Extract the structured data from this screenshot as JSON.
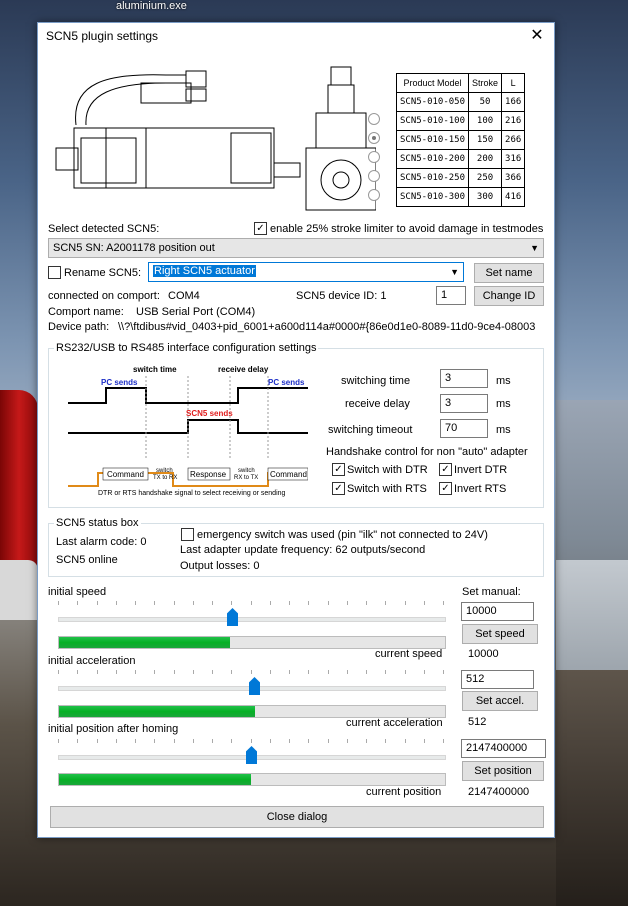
{
  "desktop": {
    "top_label": "aluminium.exe"
  },
  "dialog": {
    "title": "SCN5 plugin settings",
    "close_glyph": "✕"
  },
  "product_table": {
    "headers": [
      "Product Model",
      "Stroke",
      "L"
    ],
    "rows": [
      [
        "SCN5-010-050",
        "50",
        "166"
      ],
      [
        "SCN5-010-100",
        "100",
        "216"
      ],
      [
        "SCN5-010-150",
        "150",
        "266"
      ],
      [
        "SCN5-010-200",
        "200",
        "316"
      ],
      [
        "SCN5-010-250",
        "250",
        "366"
      ],
      [
        "SCN5-010-300",
        "300",
        "416"
      ]
    ],
    "selected_index": 1
  },
  "device": {
    "select_label": "Select detected SCN5:",
    "stroke_limiter_label": "enable 25% stroke limiter to avoid damage in testmodes",
    "stroke_limiter_checked": true,
    "selected_device": "SCN5 SN: A2001178 position out",
    "rename_label": "Rename SCN5:",
    "rename_checked": false,
    "rename_value": "Right SCN5 actuator",
    "set_name_button": "Set name",
    "comport_label": "connected on comport:",
    "comport_value": "COM4",
    "device_id_label": "SCN5 device ID: 1",
    "device_id_value": "1",
    "change_id_button": "Change ID",
    "comport_name_label": "Comport name:",
    "comport_name_value": "USB Serial Port (COM4)",
    "device_path_label": "Device path:",
    "device_path_value": "\\\\?\\ftdibus#vid_0403+pid_6001+a600d114a#0000#{86e0d1e0-8089-11d0-9ce4-08003"
  },
  "rs232": {
    "group_title": "RS232/USB to RS485 interface configuration settings",
    "diagram": {
      "switch_time": "switch time",
      "receive_delay": "receive delay",
      "pc_sends": "PC sends",
      "scn5_sends": "SCN5 sends",
      "command": "Command",
      "switch_tx_rx_1": "switch",
      "switch_tx_rx_2": "TX to RX",
      "response": "Response",
      "switch_rx_tx_1": "switch",
      "switch_rx_tx_2": "RX to TX",
      "handshake_caption": "DTR or RTS handshake signal to select receiving or sending"
    },
    "switching_time_label": "switching time",
    "switching_time_value": "3",
    "receive_delay_label": "receive delay",
    "receive_delay_value": "3",
    "switching_timeout_label": "switching timeout",
    "switching_timeout_value": "70",
    "unit_ms": "ms",
    "handshake_label": "Handshake control for non \"auto\" adapter",
    "switch_dtr_label": "Switch with DTR",
    "invert_dtr_label": "Invert DTR",
    "switch_rts_label": "Switch with RTS",
    "invert_rts_label": "Invert RTS",
    "switch_dtr_checked": true,
    "invert_dtr_checked": true,
    "switch_rts_checked": true,
    "invert_rts_checked": true
  },
  "status": {
    "group_title": "SCN5 status box",
    "last_alarm": "Last alarm code: 0",
    "online": "SCN5 online",
    "emergency_label": "emergency switch was used (pin \"ilk\" not connected to 24V)",
    "emergency_checked": false,
    "update_freq": "Last adapter update frequency: 62 outputs/second",
    "output_losses": "Output losses: 0"
  },
  "controls": {
    "set_manual_label": "Set manual:",
    "speed": {
      "label": "initial speed",
      "input": "10000",
      "button": "Set speed",
      "current_label": "current speed",
      "current_value": "10000",
      "slider_fraction": 0.45,
      "progress_fraction": 0.44
    },
    "accel": {
      "label": "initial acceleration",
      "input": "512",
      "button": "Set accel.",
      "current_label": "current acceleration",
      "current_value": "512",
      "slider_fraction": 0.51,
      "progress_fraction": 0.505
    },
    "position": {
      "label": "initial position after homing",
      "input": "2147400000",
      "button": "Set position",
      "current_label": "current position",
      "current_value": "2147400000",
      "slider_fraction": 0.5,
      "progress_fraction": 0.495
    }
  },
  "close_button": "Close dialog"
}
